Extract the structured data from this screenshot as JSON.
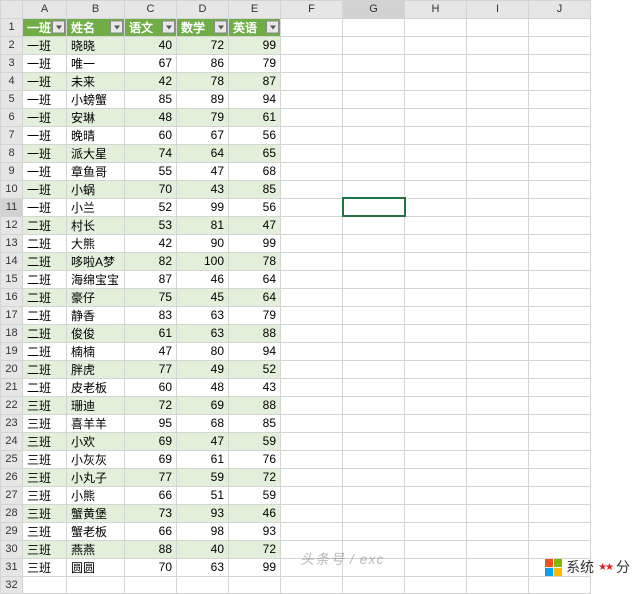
{
  "columns": [
    "A",
    "B",
    "C",
    "D",
    "E",
    "F",
    "G",
    "H",
    "I",
    "J"
  ],
  "active": {
    "row": 11,
    "col": "G"
  },
  "header": {
    "a": "一班",
    "b": "姓名",
    "c": "语文",
    "d": "数学",
    "e": "英语"
  },
  "rows": [
    {
      "n": 2,
      "a": "一班",
      "b": "晓晓",
      "c": 40,
      "d": 72,
      "e": 99
    },
    {
      "n": 3,
      "a": "一班",
      "b": "唯一",
      "c": 67,
      "d": 86,
      "e": 79
    },
    {
      "n": 4,
      "a": "一班",
      "b": "未来",
      "c": 42,
      "d": 78,
      "e": 87
    },
    {
      "n": 5,
      "a": "一班",
      "b": "小螃蟹",
      "c": 85,
      "d": 89,
      "e": 94
    },
    {
      "n": 6,
      "a": "一班",
      "b": "安琳",
      "c": 48,
      "d": 79,
      "e": 61
    },
    {
      "n": 7,
      "a": "一班",
      "b": "晚晴",
      "c": 60,
      "d": 67,
      "e": 56
    },
    {
      "n": 8,
      "a": "一班",
      "b": "派大星",
      "c": 74,
      "d": 64,
      "e": 65
    },
    {
      "n": 9,
      "a": "一班",
      "b": "章鱼哥",
      "c": 55,
      "d": 47,
      "e": 68
    },
    {
      "n": 10,
      "a": "一班",
      "b": "小蜗",
      "c": 70,
      "d": 43,
      "e": 85
    },
    {
      "n": 11,
      "a": "一班",
      "b": "小兰",
      "c": 52,
      "d": 99,
      "e": 56
    },
    {
      "n": 12,
      "a": "二班",
      "b": "村长",
      "c": 53,
      "d": 81,
      "e": 47
    },
    {
      "n": 13,
      "a": "二班",
      "b": "大熊",
      "c": 42,
      "d": 90,
      "e": 99
    },
    {
      "n": 14,
      "a": "二班",
      "b": "哆啦A梦",
      "c": 82,
      "d": 100,
      "e": 78
    },
    {
      "n": 15,
      "a": "二班",
      "b": "海绵宝宝",
      "c": 87,
      "d": 46,
      "e": 64
    },
    {
      "n": 16,
      "a": "二班",
      "b": "豪仔",
      "c": 75,
      "d": 45,
      "e": 64
    },
    {
      "n": 17,
      "a": "二班",
      "b": "静香",
      "c": 83,
      "d": 63,
      "e": 79
    },
    {
      "n": 18,
      "a": "二班",
      "b": "俊俊",
      "c": 61,
      "d": 63,
      "e": 88
    },
    {
      "n": 19,
      "a": "二班",
      "b": "楠楠",
      "c": 47,
      "d": 80,
      "e": 94
    },
    {
      "n": 20,
      "a": "二班",
      "b": "胖虎",
      "c": 77,
      "d": 49,
      "e": 52
    },
    {
      "n": 21,
      "a": "二班",
      "b": "皮老板",
      "c": 60,
      "d": 48,
      "e": 43
    },
    {
      "n": 22,
      "a": "三班",
      "b": "珊迪",
      "c": 72,
      "d": 69,
      "e": 88
    },
    {
      "n": 23,
      "a": "三班",
      "b": "喜羊羊",
      "c": 95,
      "d": 68,
      "e": 85
    },
    {
      "n": 24,
      "a": "三班",
      "b": "小欢",
      "c": 69,
      "d": 47,
      "e": 59
    },
    {
      "n": 25,
      "a": "三班",
      "b": "小灰灰",
      "c": 69,
      "d": 61,
      "e": 76
    },
    {
      "n": 26,
      "a": "三班",
      "b": "小丸子",
      "c": 77,
      "d": 59,
      "e": 72
    },
    {
      "n": 27,
      "a": "三班",
      "b": "小熊",
      "c": 66,
      "d": 51,
      "e": 59
    },
    {
      "n": 28,
      "a": "三班",
      "b": "蟹黄堡",
      "c": 73,
      "d": 93,
      "e": 46
    },
    {
      "n": 29,
      "a": "三班",
      "b": "蟹老板",
      "c": 66,
      "d": 98,
      "e": 93
    },
    {
      "n": 30,
      "a": "三班",
      "b": "燕燕",
      "c": 88,
      "d": 40,
      "e": 72
    },
    {
      "n": 31,
      "a": "三班",
      "b": "圆圆",
      "c": 70,
      "d": 63,
      "e": 99
    }
  ],
  "emptyRow": 32,
  "watermark1": "头条号 / exc",
  "watermark2": "系统",
  "watermark2b": "分"
}
